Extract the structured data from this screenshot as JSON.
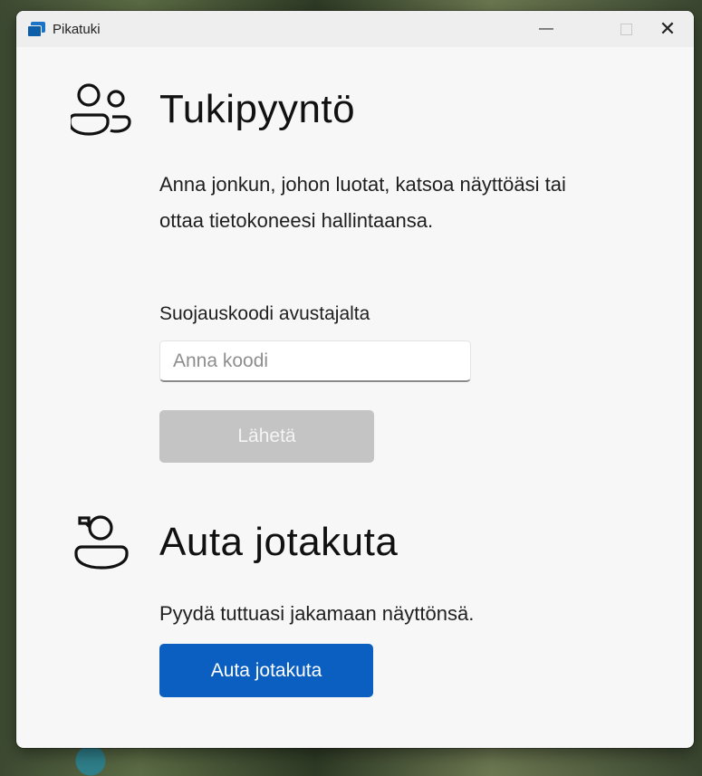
{
  "window": {
    "app_title": "Pikatuki",
    "minimize_symbol": "—",
    "close_symbol": "✕",
    "app_icon": "quick-assist-icon"
  },
  "request_help": {
    "icon": "people-icon",
    "title": "Tukipyyntö",
    "description": "Anna jonkun, johon luotat, katsoa näyttöäsi tai ottaa tietokoneesi hallintaansa.",
    "code_label": "Suojauskoodi avustajalta",
    "code_input": {
      "value": "",
      "placeholder": "Anna koodi"
    },
    "submit_label": "Lähetä",
    "submit_enabled": false
  },
  "help_someone": {
    "icon": "person-chat-icon",
    "title": "Auta jotakuta",
    "description": "Pyydä tuttuasi jakamaan näyttönsä.",
    "button_label": "Auta jotakuta"
  },
  "colors": {
    "primary": "#0a5fc0",
    "disabled": "#c4c4c4",
    "window_bg": "#f7f7f7"
  }
}
